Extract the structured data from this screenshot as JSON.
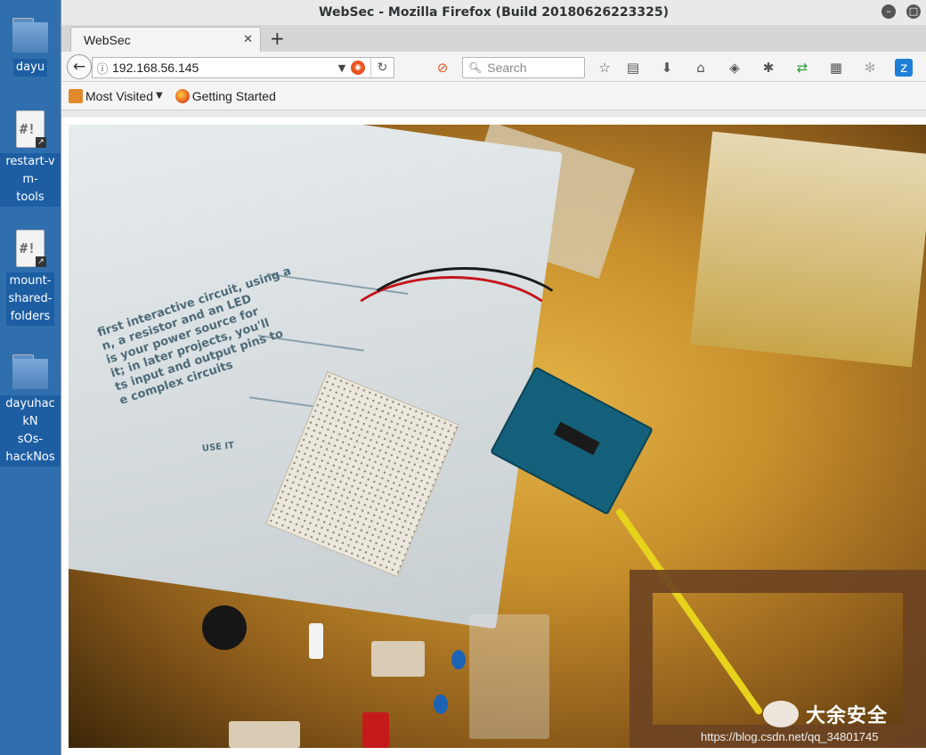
{
  "desktop": {
    "icons": [
      {
        "label": "dayu",
        "type": "folder"
      },
      {
        "label": "restart-vm-\ntools",
        "type": "script"
      },
      {
        "label": "mount-\nshared-\nfolders",
        "type": "script"
      },
      {
        "label": "dayuhackN\nsOs-\nhackNos",
        "type": "folder"
      }
    ]
  },
  "window": {
    "title": "WebSec - Mozilla Firefox (Build 20180626223325)",
    "tab_title": "WebSec",
    "url": "192.168.56.145",
    "search_placeholder": "Search",
    "bookmarks": [
      "Most Visited",
      "Getting Started"
    ]
  },
  "photo": {
    "book_heading": "first interactive circuit, using a\nn, a resistor and an LED\n is your power source for\nit; in later projects, you'll\nts input and output pins to\ne complex circuits",
    "book_caption": "USE IT",
    "watermark_name": "大余安全",
    "watermark_url": "https://blog.csdn.net/qq_34801745"
  },
  "colors": {
    "desktop_bg": "#2f6fad",
    "ubuntu_orange": "#e95420",
    "cable_yellow": "#e7d21c",
    "board_teal": "#14607b"
  }
}
